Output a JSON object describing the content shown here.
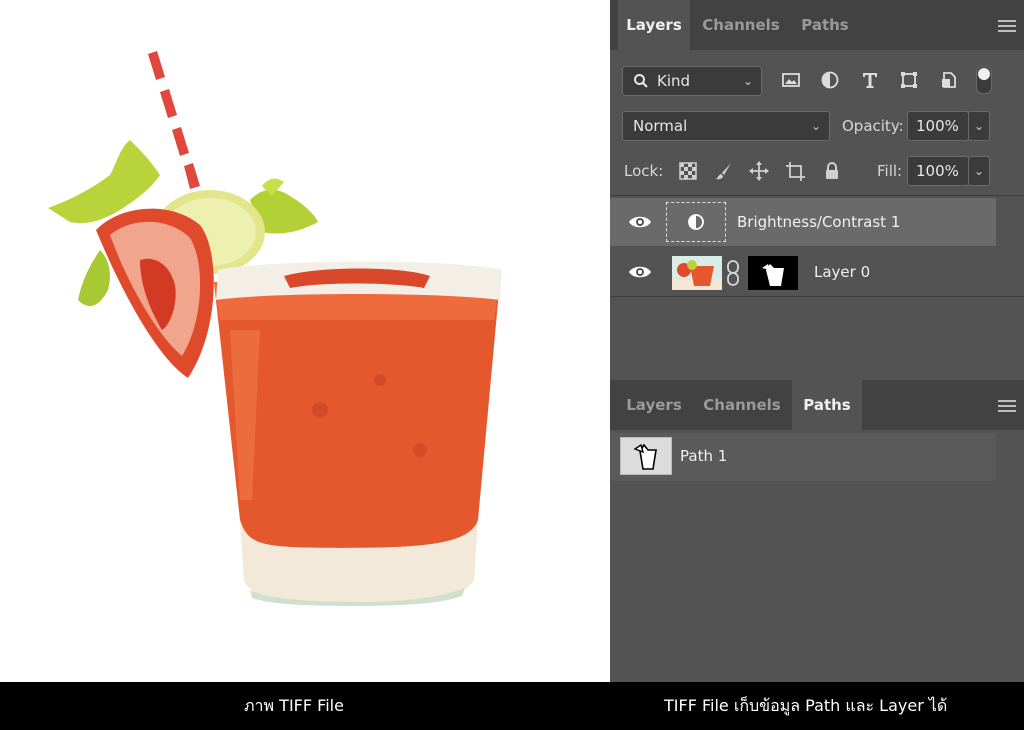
{
  "left_caption": "ภาพ TIFF File",
  "right_caption": "TIFF File เก็บข้อมูล Path และ Layer ได้",
  "layers_panel": {
    "tabs": [
      {
        "label": "Layers",
        "active": true
      },
      {
        "label": "Channels",
        "active": false
      },
      {
        "label": "Paths",
        "active": false
      }
    ],
    "filter_label": "Kind",
    "filter_icons": [
      "image-filter-icon",
      "adjustment-filter-icon",
      "type-filter-icon",
      "shape-filter-icon",
      "smart-object-filter-icon"
    ],
    "blend_mode": "Normal",
    "opacity_label": "Opacity:",
    "opacity_value": "100%",
    "lock_label": "Lock:",
    "lock_icons": [
      "lock-transparent-icon",
      "lock-image-icon",
      "lock-position-icon",
      "lock-artboard-icon",
      "lock-all-icon"
    ],
    "fill_label": "Fill:",
    "fill_value": "100%",
    "layers": [
      {
        "name": "Brightness/Contrast 1",
        "selected": true,
        "visible": true
      },
      {
        "name": "Layer 0",
        "selected": false,
        "visible": true
      }
    ]
  },
  "paths_panel": {
    "tabs": [
      {
        "label": "Layers",
        "active": false
      },
      {
        "label": "Channels",
        "active": false
      },
      {
        "label": "Paths",
        "active": true
      }
    ],
    "paths": [
      {
        "name": "Path 1"
      }
    ]
  },
  "colors": {
    "panel_bg": "#535353",
    "tab_bg": "#424242",
    "selected_row": "#6a6a6a",
    "caption_bg": "#000000"
  }
}
